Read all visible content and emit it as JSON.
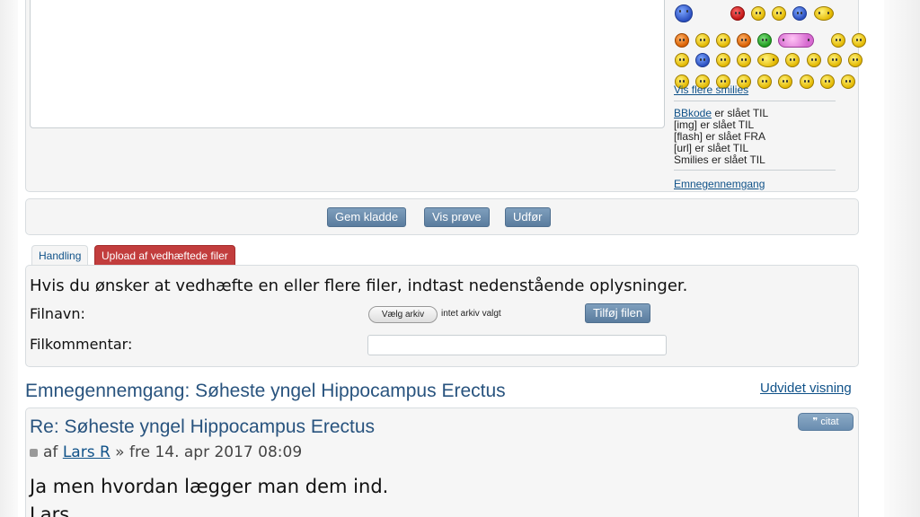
{
  "smilies": {
    "rows": [
      [
        "smiley-fish-icon",
        "smiley-red-icon",
        "smiley-grin-icon",
        "smiley-laugh-icon",
        "smiley-blue-icon",
        "smiley-sleep-icon"
      ],
      [
        "smiley-devil-icon",
        "smiley-cat-icon",
        "smiley-angry-icon",
        "smiley-sad-icon",
        "smiley-green-icon",
        "smiley-love-icon",
        "smiley-group-icon",
        "smiley-smile-icon",
        "smiley-confused-icon"
      ],
      [
        "smiley-cry-icon",
        "smiley-blue2-icon",
        "smiley-music-icon",
        "smiley-wink-icon",
        "smiley-cool-icon",
        "smiley-ha-icon",
        "smiley-crazy-icon",
        "smiley-tongue-icon",
        "smiley-hmm-icon",
        "smiley-happy-icon"
      ],
      [
        "smiley-eek-icon",
        "smiley-shock-icon",
        "smiley-evil-icon",
        "smiley-geek-icon",
        "smiley-roll-icon",
        "smiley-surprised-icon",
        "smiley-razz-icon",
        "smiley-twisted-icon",
        "smiley-biggrin-icon",
        "smiley-thinking-icon"
      ]
    ],
    "more_link": "Vis flere smilies"
  },
  "bbcode": {
    "bbcode_link": "BBkode",
    "bbcode_status": " er slået TIL",
    "img_status": "[img] er slået TIL",
    "flash_status": "[flash] er slået FRA",
    "url_status": "[url] er slået TIL",
    "smilies_status": "Smilies er slået TIL",
    "topic_review_link": "Emnegennemgang"
  },
  "buttons": {
    "save_draft": "Gem kladde",
    "preview": "Vis prøve",
    "submit": "Udfør"
  },
  "tabs": {
    "handling": "Handling",
    "upload": "Upload af vedhæftede filer"
  },
  "upload": {
    "intro": "Hvis du ønsker at vedhæfte en eller flere filer, indtast nedenstående oplysninger.",
    "filename_label": "Filnavn:",
    "choose_file": "Vælg arkiv",
    "no_file": "intet arkiv valgt",
    "add_file": "Tilføj filen",
    "comment_label": "Filkommentar:",
    "comment_value": ""
  },
  "topic_review": {
    "heading": "Emnegennemgang: Søheste yngel Hippocampus Erectus",
    "extended_view": "Udvidet visning"
  },
  "post": {
    "title": "Re: Søheste yngel Hippocampus Erectus",
    "quote_label": "❞ citat",
    "by": "af",
    "author": "Lars R",
    "date": "» fre 14. apr 2017 08:09",
    "body_line1": "Ja men hvordan lægger man dem ind.",
    "body_line2": "Lars"
  }
}
